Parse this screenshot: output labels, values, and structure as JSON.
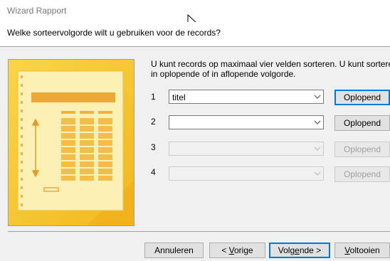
{
  "window": {
    "title": "Wizard Rapport"
  },
  "header": {
    "question": "Welke sorteervolgorde wilt u gebruiken voor de records?"
  },
  "instructions": {
    "line1": "U kunt records op maximaal vier velden sorteren. U kunt sorteren",
    "line2": "in oplopende of in aflopende volgorde."
  },
  "sort_rows": [
    {
      "number": "1",
      "field": "titel",
      "order": "Oplopend",
      "enabled": true
    },
    {
      "number": "2",
      "field": "",
      "order": "Oplopend",
      "enabled": true
    },
    {
      "number": "3",
      "field": "",
      "order": "Oplopend",
      "enabled": false
    },
    {
      "number": "4",
      "field": "",
      "order": "Oplopend",
      "enabled": false
    }
  ],
  "footer": {
    "cancel": "Annuleren",
    "back_prefix": "< ",
    "back_key": "V",
    "back_rest": "orige",
    "next_prefix": "Volg",
    "next_key": "e",
    "next_rest": "nde >",
    "finish_key": "V",
    "finish_rest": "oltooien"
  },
  "colors": {
    "accent": "#0078d7",
    "illustration_yellow": "#f8c82c",
    "illustration_orange": "#e8a21a"
  },
  "icons": {
    "dropdown": "chevron-down-icon",
    "pointer": "mouse-pointer-icon"
  }
}
